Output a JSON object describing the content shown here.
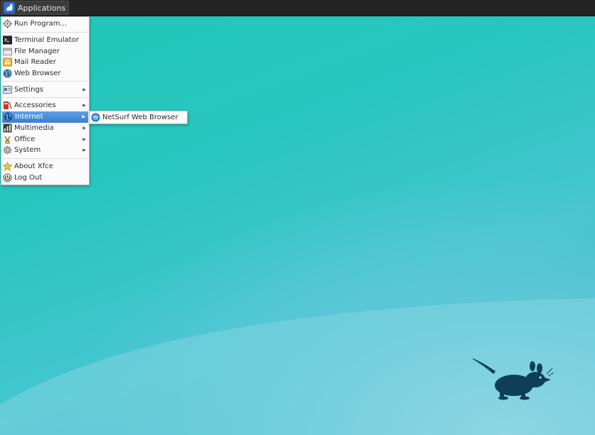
{
  "panel": {
    "applications_label": "Applications",
    "applications_icon": "xfce-mouse-icon"
  },
  "menu": {
    "items": [
      {
        "label": "Run Program...",
        "icon": "run-icon"
      },
      {
        "label": "Terminal Emulator",
        "icon": "terminal-icon"
      },
      {
        "label": "File Manager",
        "icon": "file-manager-icon"
      },
      {
        "label": "Mail Reader",
        "icon": "mail-icon"
      },
      {
        "label": "Web Browser",
        "icon": "globe-icon"
      },
      {
        "label": "Settings",
        "icon": "settings-icon",
        "has_submenu": true
      },
      {
        "label": "Accessories",
        "icon": "accessories-icon",
        "has_submenu": true
      },
      {
        "label": "Internet",
        "icon": "internet-icon",
        "has_submenu": true,
        "active": true
      },
      {
        "label": "Multimedia",
        "icon": "multimedia-icon",
        "has_submenu": true
      },
      {
        "label": "Office",
        "icon": "office-icon",
        "has_submenu": true
      },
      {
        "label": "System",
        "icon": "system-gear-icon",
        "has_submenu": true
      },
      {
        "label": "About Xfce",
        "icon": "star-icon"
      },
      {
        "label": "Log Out",
        "icon": "power-icon"
      }
    ]
  },
  "submenu": {
    "items": [
      {
        "label": "NetSurf Web Browser",
        "icon": "netsurf-icon"
      }
    ]
  },
  "colors": {
    "panel_bg": "#242424",
    "menu_bg": "#fbfbfb",
    "highlight": "#3b7fcf",
    "desktop_teal": "#29c5c0",
    "mouse_logo": "#0f3f57"
  }
}
